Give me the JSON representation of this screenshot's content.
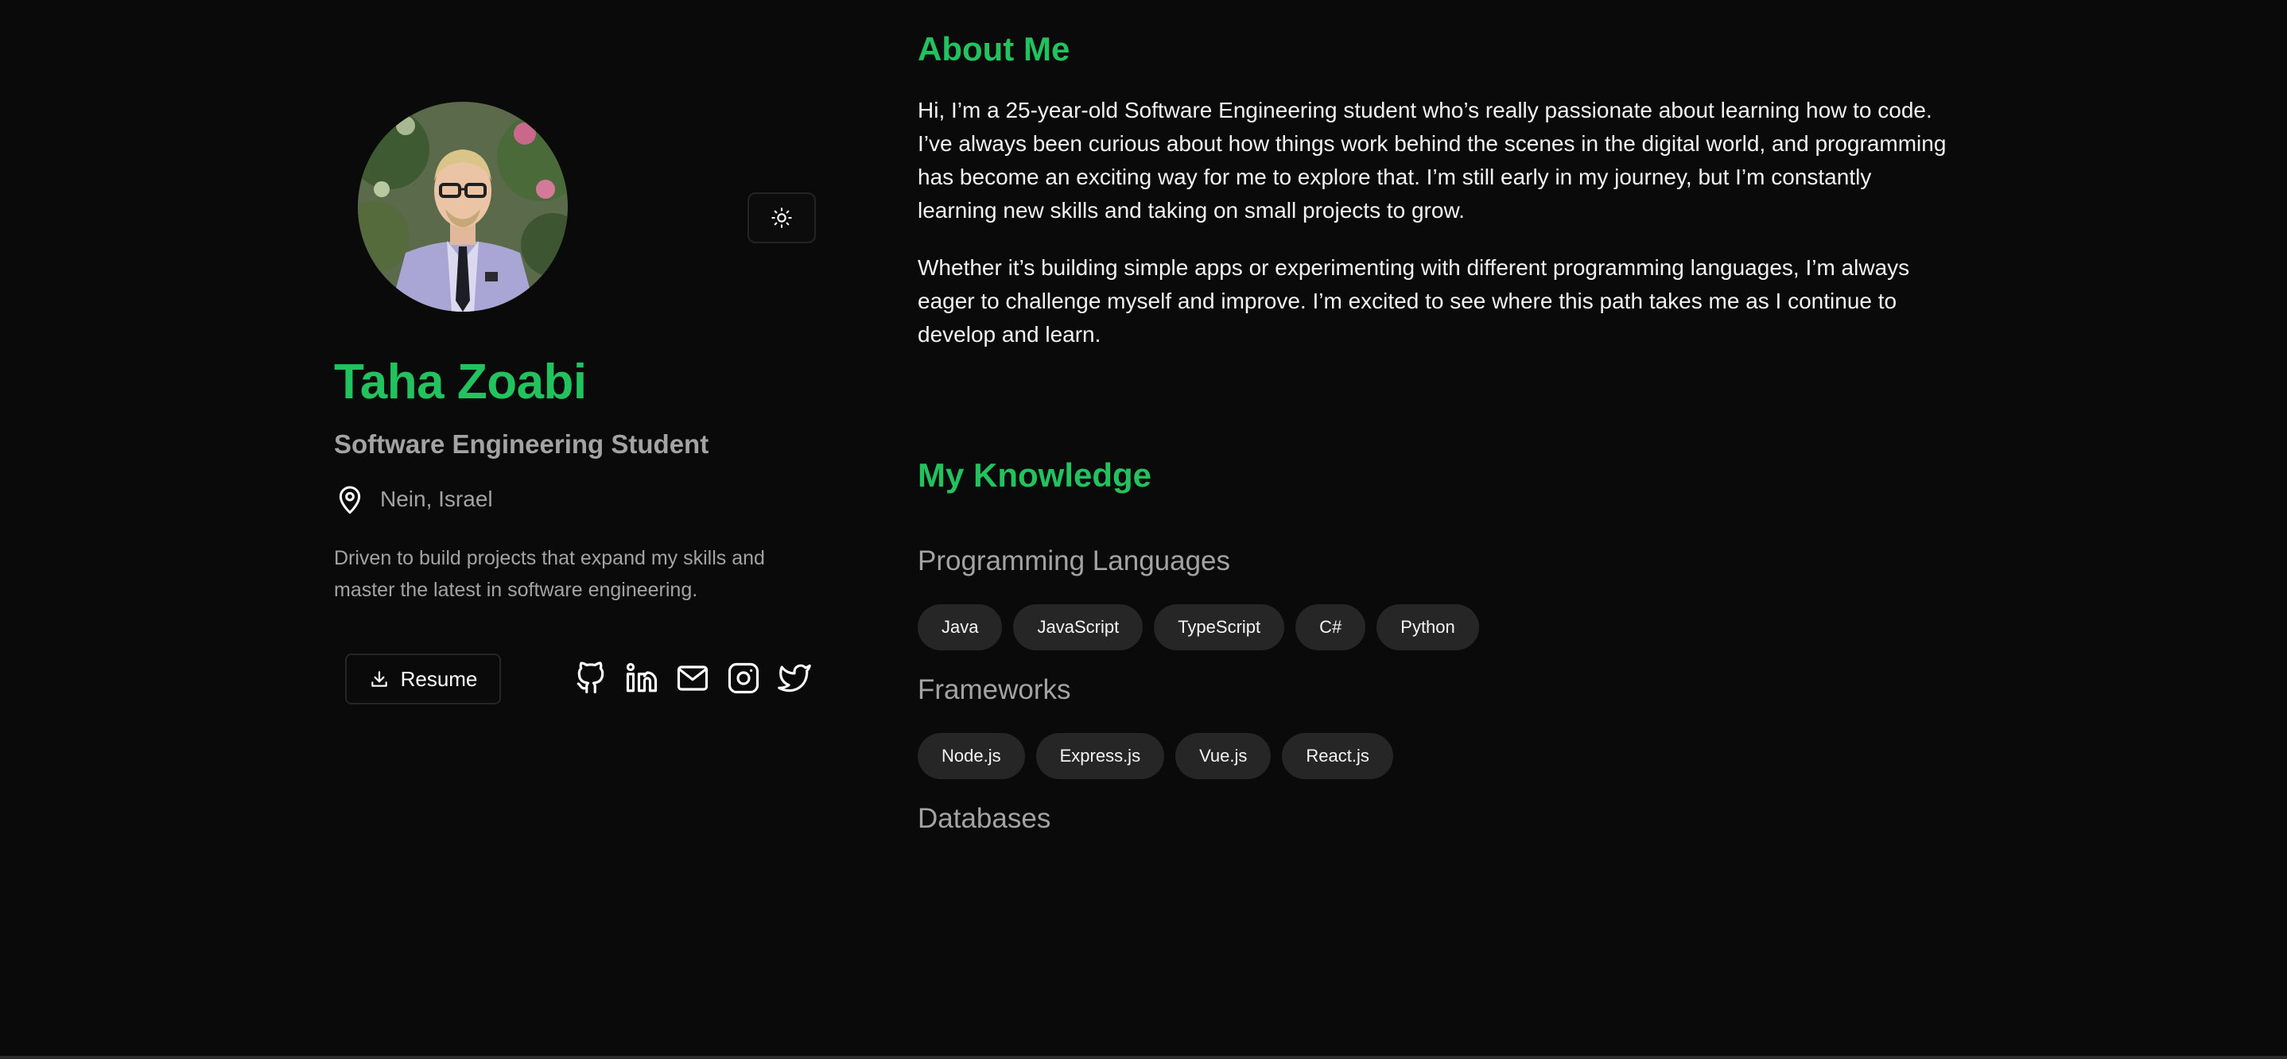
{
  "profile": {
    "name": "Taha Zoabi",
    "role": "Software Engineering Student",
    "location": "Nein, Israel",
    "bio": "Driven to build projects that expand my skills and master the latest in software engineering.",
    "resume_label": "Resume",
    "socials": [
      "github-icon",
      "linkedin-icon",
      "mail-icon",
      "instagram-icon",
      "twitter-icon"
    ]
  },
  "about": {
    "title": "About Me",
    "paragraphs": [
      "Hi, I’m a 25-year-old Software Engineering student who’s really passionate about learning how to code. I’ve always been curious about how things work behind the scenes in the digital world, and programming has become an exciting way for me to explore that. I’m still early in my journey, but I’m constantly learning new skills and taking on small projects to grow.",
      "Whether it’s building simple apps or experimenting with different programming languages, I’m always eager to challenge myself and improve. I’m excited to see where this path takes me as I continue to develop and learn."
    ]
  },
  "knowledge": {
    "title": "My Knowledge",
    "categories": [
      {
        "title": "Programming Languages",
        "items": [
          "Java",
          "JavaScript",
          "TypeScript",
          "C#",
          "Python"
        ]
      },
      {
        "title": "Frameworks",
        "items": [
          "Node.js",
          "Express.js",
          "Vue.js",
          "React.js"
        ]
      },
      {
        "title": "Databases",
        "items": []
      }
    ]
  },
  "colors": {
    "background": "#0a0a0a",
    "accent": "#22c35e",
    "muted_text": "#a3a3a3",
    "tag_background": "#262626"
  }
}
